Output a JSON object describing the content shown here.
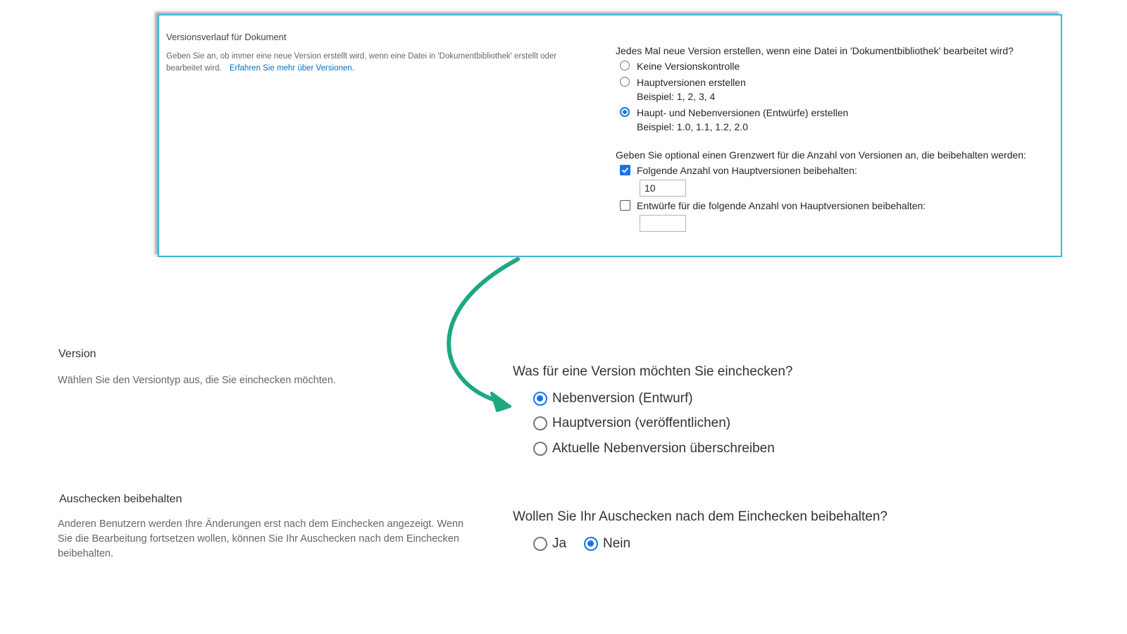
{
  "colors": {
    "panel_border": "#41b6d6",
    "link": "#0072c6",
    "accent": "#1a73e8",
    "arrow": "#1ea882"
  },
  "panel": {
    "title": "Versionsverlauf für Dokument",
    "description": "Geben Sie an, ob immer eine neue Version erstellt wird, wenn eine Datei in 'Dokumentbibliothek' erstellt oder bearbeitet wird.",
    "link": "Erfahren Sie mehr über Versionen.",
    "question": "Jedes Mal neue Version erstellen, wenn eine Datei in 'Dokumentbibliothek' bearbeitet wird?",
    "options": [
      {
        "label": "Keine Versionskontrolle",
        "example": "",
        "selected": false
      },
      {
        "label": "Hauptversionen erstellen",
        "example": "Beispiel: 1, 2, 3, 4",
        "selected": false
      },
      {
        "label": "Haupt- und Nebenversionen (Entwürfe) erstellen",
        "example": "Beispiel: 1.0, 1.1, 1.2, 2.0",
        "selected": true
      }
    ],
    "limit_text": "Geben Sie optional einen Grenzwert für die Anzahl von Versionen an, die beibehalten werden:",
    "keep_major": {
      "label": "Folgende Anzahl von Hauptversionen beibehalten:",
      "checked": true,
      "value": "10"
    },
    "keep_drafts": {
      "label": "Entwürfe für die folgende Anzahl von Hauptversionen beibehalten:",
      "checked": false,
      "value": ""
    }
  },
  "version_section": {
    "label": "Version",
    "description": "Wählen Sie den Versiontyp aus, die Sie einchecken möchten.",
    "question": "Was für eine Version möchten Sie einchecken?",
    "options": [
      {
        "label": "Nebenversion (Entwurf)",
        "selected": true
      },
      {
        "label": "Hauptversion (veröffentlichen)",
        "selected": false
      },
      {
        "label": "Aktuelle Nebenversion überschreiben",
        "selected": false
      }
    ]
  },
  "checkout_section": {
    "label": "Auschecken beibehalten",
    "description": "Anderen Benutzern werden Ihre Änderungen erst nach dem Einchecken angezeigt. Wenn Sie die Bearbeitung fortsetzen wollen, können Sie Ihr Auschecken nach dem Einchecken beibehalten.",
    "question": "Wollen Sie Ihr Auschecken nach dem Einchecken beibehalten?",
    "options": [
      {
        "label": "Ja",
        "selected": false
      },
      {
        "label": "Nein",
        "selected": true
      }
    ]
  }
}
